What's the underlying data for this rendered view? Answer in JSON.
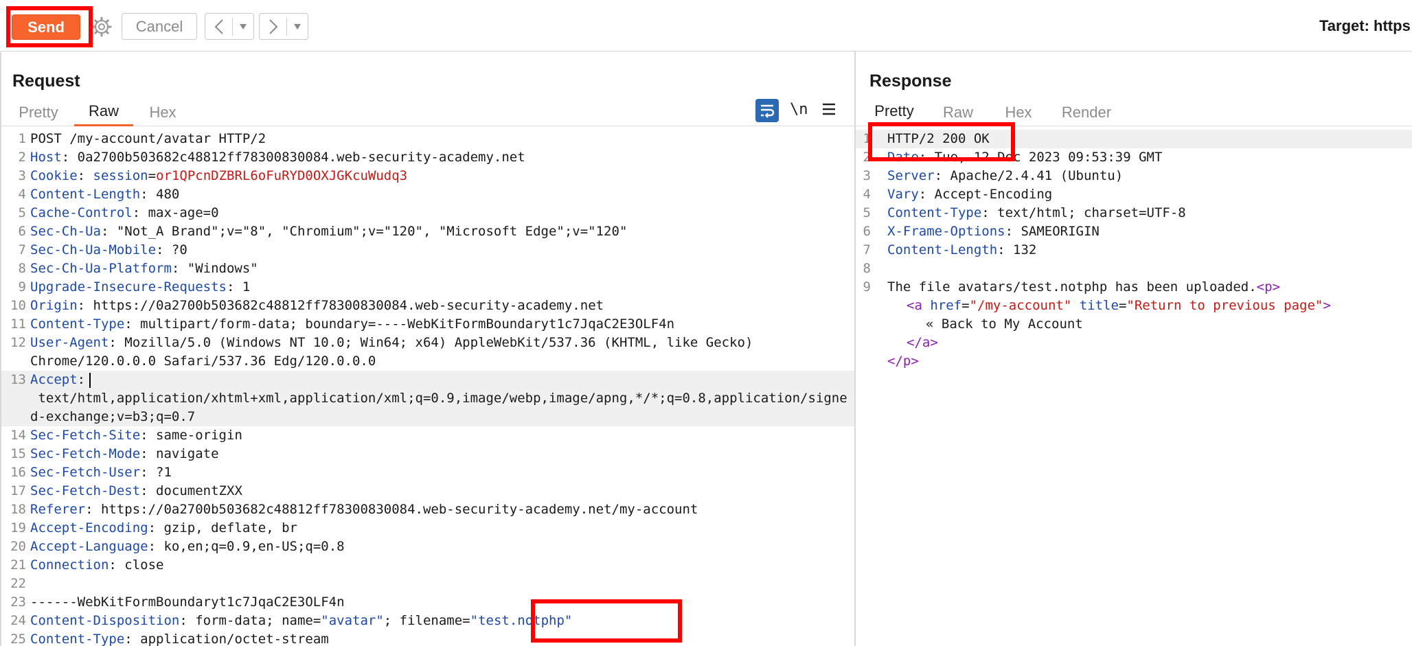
{
  "toolbar": {
    "send_label": "Send",
    "cancel_label": "Cancel",
    "target_label": "Target: https"
  },
  "request": {
    "title": "Request",
    "tabs": [
      "Pretty",
      "Raw",
      "Hex"
    ],
    "active_tab": "Raw",
    "newline_toggle": "\\n",
    "lines": [
      {
        "n": "1",
        "text": "POST /my-account/avatar HTTP/2"
      },
      {
        "n": "2",
        "key": "Host",
        "value": " 0a2700b503682c48812ff78300830084.web-security-academy.net"
      },
      {
        "n": "3",
        "key": "Cookie",
        "cookie_name": "session",
        "cookie_value": "or1QPcnDZBRL6oFuRYD0OXJGKcuWudq3"
      },
      {
        "n": "4",
        "key": "Content-Length",
        "value": " 480"
      },
      {
        "n": "5",
        "key": "Cache-Control",
        "value": " max-age=0"
      },
      {
        "n": "6",
        "key": "Sec-Ch-Ua",
        "value": " \"Not_A Brand\";v=\"8\", \"Chromium\";v=\"120\", \"Microsoft Edge\";v=\"120\""
      },
      {
        "n": "7",
        "key": "Sec-Ch-Ua-Mobile",
        "value": " ?0"
      },
      {
        "n": "8",
        "key": "Sec-Ch-Ua-Platform",
        "value": " \"Windows\""
      },
      {
        "n": "9",
        "key": "Upgrade-Insecure-Requests",
        "value": " 1"
      },
      {
        "n": "10",
        "key": "Origin",
        "value": " https://0a2700b503682c48812ff78300830084.web-security-academy.net"
      },
      {
        "n": "11",
        "key": "Content-Type",
        "value": " multipart/form-data; boundary=----WebKitFormBoundaryt1c7JqaC2E3OLF4n"
      },
      {
        "n": "12",
        "key": "User-Agent",
        "value": " Mozilla/5.0 (Windows NT 10.0; Win64; x64) AppleWebKit/537.36 (KHTML, like Gecko) Chrome/120.0.0.0 Safari/537.36 Edg/120.0.0.0"
      },
      {
        "n": "13",
        "key": "Accept",
        "value": " text/html,application/xhtml+xml,application/xml;q=0.9,image/webp,image/apng,*/*;q=0.8,application/signed-exchange;v=b3;q=0.7"
      },
      {
        "n": "14",
        "key": "Sec-Fetch-Site",
        "value": " same-origin"
      },
      {
        "n": "15",
        "key": "Sec-Fetch-Mode",
        "value": " navigate"
      },
      {
        "n": "16",
        "key": "Sec-Fetch-User",
        "value": " ?1"
      },
      {
        "n": "17",
        "key": "Sec-Fetch-Dest",
        "value": " documentZXX"
      },
      {
        "n": "18",
        "key": "Referer",
        "value": " https://0a2700b503682c48812ff78300830084.web-security-academy.net/my-account"
      },
      {
        "n": "19",
        "key": "Accept-Encoding",
        "value": " gzip, deflate, br"
      },
      {
        "n": "20",
        "key": "Accept-Language",
        "value": " ko,en;q=0.9,en-US;q=0.8"
      },
      {
        "n": "21",
        "key": "Connection",
        "value": " close"
      },
      {
        "n": "22",
        "text": ""
      },
      {
        "n": "23",
        "text": "------WebKitFormBoundaryt1c7JqaC2E3OLF4n"
      },
      {
        "n": "24",
        "key": "Content-Disposition",
        "value_pre": " form-data; name=",
        "name_val": "\"avatar\"",
        "value_mid": "; filename=",
        "filename_val": "\"test.notphp\""
      },
      {
        "n": "25",
        "key": "Content-Type",
        "value": " application/octet-stream"
      }
    ]
  },
  "response": {
    "title": "Response",
    "tabs": [
      "Pretty",
      "Raw",
      "Hex",
      "Render"
    ],
    "active_tab": "Pretty",
    "lines": [
      {
        "n": "1",
        "text": "HTTP/2 200 OK"
      },
      {
        "n": "2",
        "key": "Date",
        "value": " Tue, 12 Dec 2023 09:53:39 GMT"
      },
      {
        "n": "3",
        "key": "Server",
        "value": " Apache/2.4.41 (Ubuntu)"
      },
      {
        "n": "4",
        "key": "Vary",
        "value": " Accept-Encoding"
      },
      {
        "n": "5",
        "key": "Content-Type",
        "value": " text/html; charset=UTF-8"
      },
      {
        "n": "6",
        "key": "X-Frame-Options",
        "value": " SAMEORIGIN"
      },
      {
        "n": "7",
        "key": "Content-Length",
        "value": " 132"
      },
      {
        "n": "8",
        "text": ""
      },
      {
        "n": "9",
        "text": "The file avatars/test.notphp has been uploaded."
      }
    ],
    "html_body": {
      "p_open": "<p>",
      "a_open": "<a",
      "href_attr": "href",
      "href_val": "\"/my-account\"",
      "title_attr": "title",
      "title_val": "\"Return to previous page\"",
      "gt": ">",
      "link_text": "« Back to My Account",
      "a_close": "</a>",
      "p_close": "</p>"
    }
  },
  "colors": {
    "accent": "#f7632d",
    "header_key": "#1d49a7",
    "cookie_value": "#c41a16",
    "annotation": "#ff0000"
  },
  "icons": [
    "settings-gear-icon",
    "back-arrow-icon",
    "forward-arrow-icon",
    "dropdown-caret-icon",
    "word-wrap-icon",
    "newline-toggle-icon",
    "menu-icon"
  ]
}
